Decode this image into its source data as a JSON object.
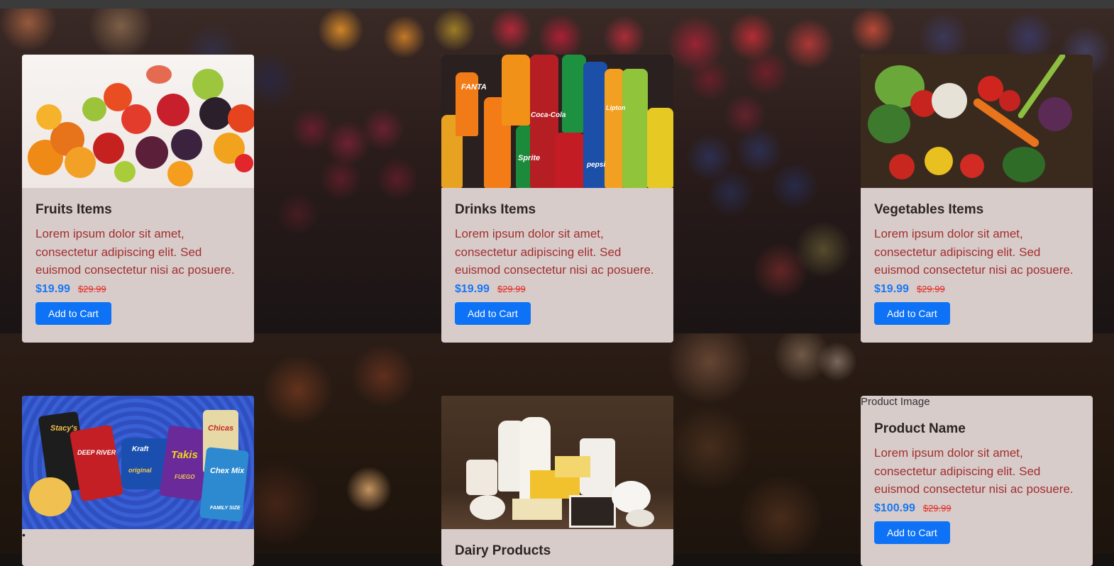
{
  "cards": [
    {
      "title": "Fruits Items",
      "description": "Lorem ipsum dolor sit amet, consectetur adipiscing elit. Sed euismod consectetur nisi ac posuere.",
      "price": "$19.99",
      "old_price": "$29.99",
      "button": "Add to Cart"
    },
    {
      "title": "Drinks Items",
      "description": "Lorem ipsum dolor sit amet, consectetur adipiscing elit. Sed euismod consectetur nisi ac posuere.",
      "price": "$19.99",
      "old_price": "$29.99",
      "button": "Add to Cart"
    },
    {
      "title": "Vegetables Items",
      "description": "Lorem ipsum dolor sit amet, consectetur adipiscing elit. Sed euismod consectetur nisi ac posuere.",
      "price": "$19.99",
      "old_price": "$29.99",
      "button": "Add to Cart"
    },
    {
      "title": "",
      "bullet": "•"
    },
    {
      "title": "Dairy Products"
    },
    {
      "image_alt": "Product Image",
      "title": "Product Name",
      "description": "Lorem ipsum dolor sit amet, consectetur adipiscing elit. Sed euismod consectetur nisi ac posuere.",
      "price": "$100.99",
      "old_price": "$29.99",
      "button": "Add to Cart"
    }
  ],
  "image_text": {
    "drinks": [
      "FANTA",
      "Coca-Cola",
      "pepsi",
      "Sprite",
      "Lipton"
    ],
    "snacks": [
      "Stacy's",
      "DEEP RIVER",
      "Kraft",
      "Takis",
      "Chex Mix",
      "Chicas",
      "original",
      "FUEGO",
      "FAMILY SIZE"
    ]
  },
  "colors": {
    "card_bg": "#d8cccb",
    "price": "#1877f2",
    "old_price": "#e03029",
    "description": "#a0302f",
    "button": "#0d72f5"
  }
}
